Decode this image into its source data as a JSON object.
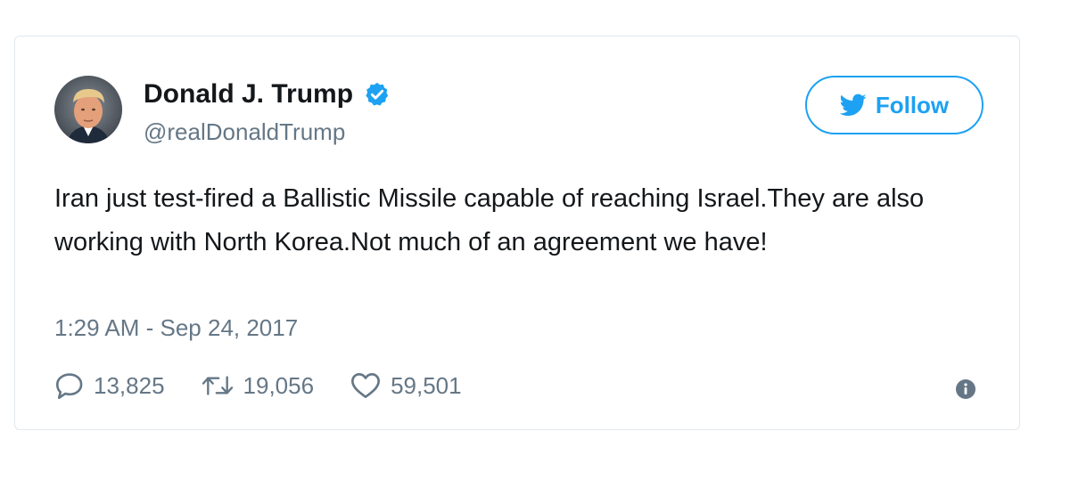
{
  "tweet": {
    "author_name": "Donald J. Trump",
    "author_handle": "@realDonaldTrump",
    "verified_icon": "verified-badge-icon",
    "follow_label": "Follow",
    "text": "Iran just test-fired a Ballistic Missile capable of reaching Israel.They are also working with North Korea.Not much of an agreement we have!",
    "timestamp": "1:29 AM - Sep 24, 2017",
    "replies": "13,825",
    "retweets": "19,056",
    "likes": "59,501"
  },
  "colors": {
    "accent": "#1da1f2",
    "text_primary": "#14171a",
    "text_secondary": "#657786",
    "border": "#e1e8ed"
  },
  "icons": {
    "reply": "reply-icon",
    "retweet": "retweet-icon",
    "like": "heart-icon",
    "info": "info-icon",
    "follow": "twitter-bird-icon"
  }
}
